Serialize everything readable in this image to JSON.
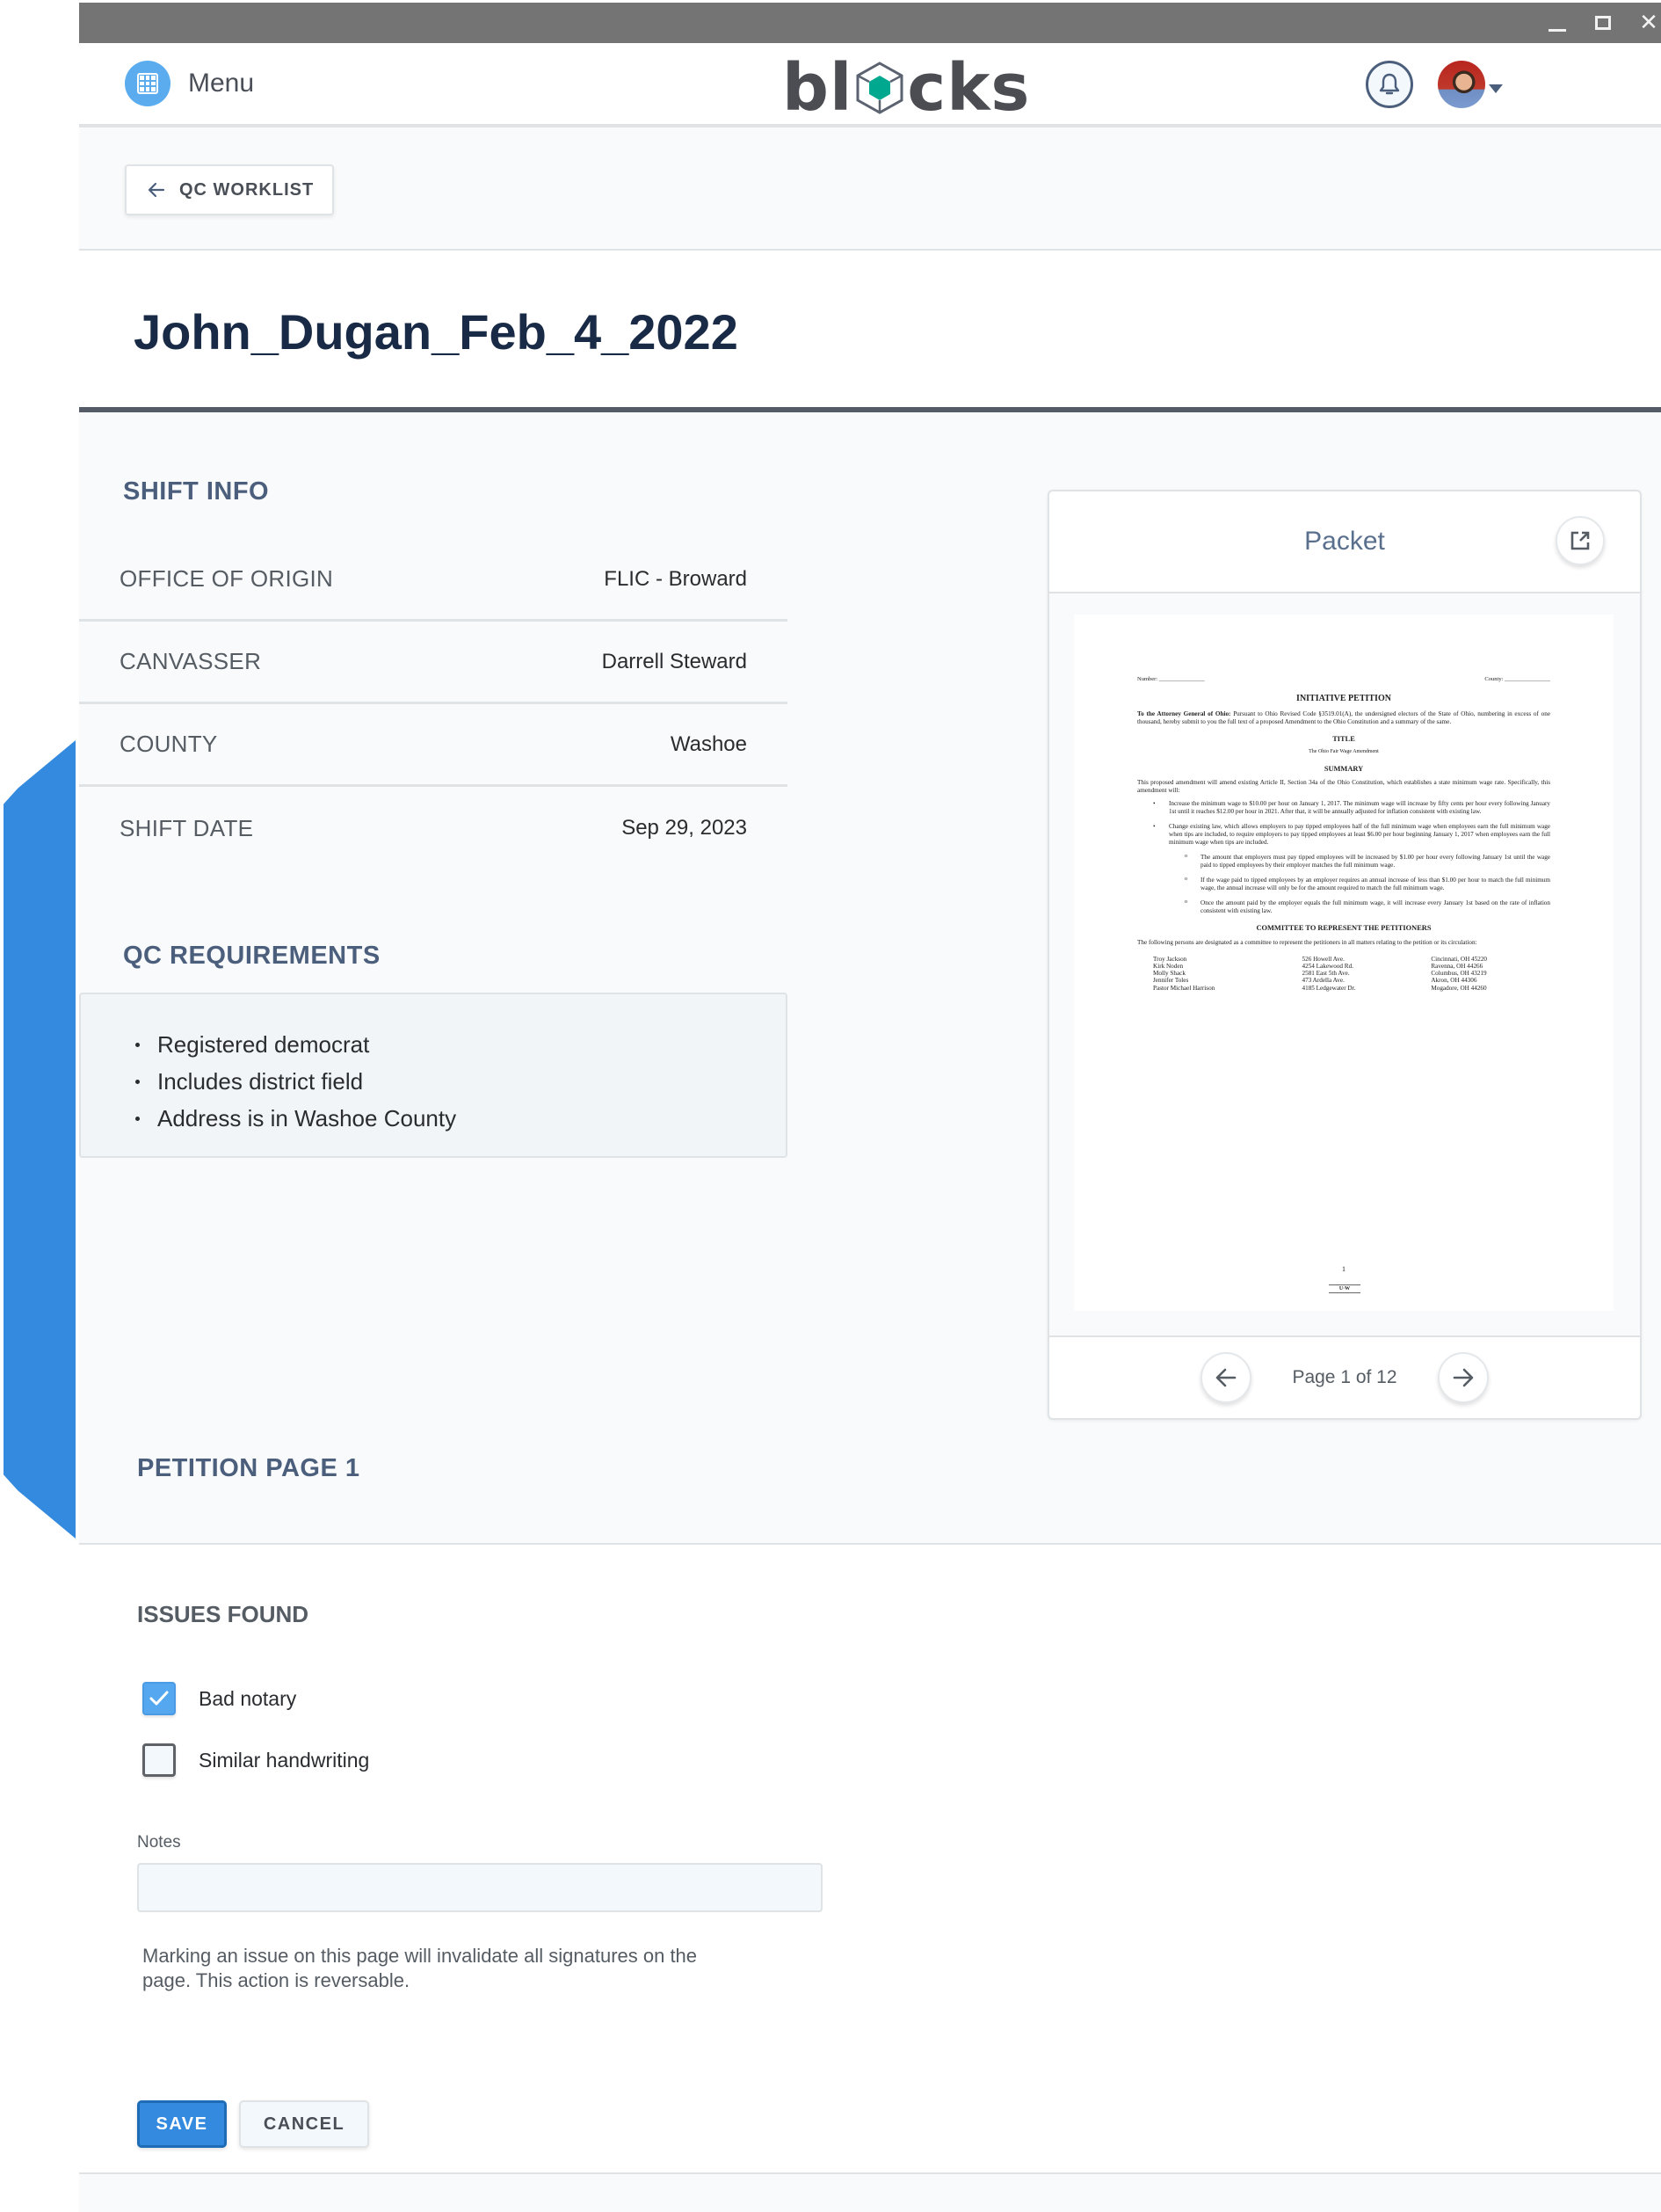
{
  "window": {
    "controls": [
      "minimize",
      "maximize",
      "close"
    ]
  },
  "topnav": {
    "menu_label": "Menu",
    "logo_prefix": "bl",
    "logo_suffix": "cks",
    "brand_color": "#00a88f",
    "bell_icon": "bell-icon",
    "avatar_icon": "user-avatar"
  },
  "breadcrumb": {
    "back_label": "QC WORKLIST",
    "back_icon": "arrow-left-icon"
  },
  "page": {
    "title": "John_Dugan_Feb_4_2022"
  },
  "shift_info": {
    "heading": "SHIFT INFO",
    "rows": [
      {
        "label": "OFFICE OF ORIGIN",
        "value": "FLIC - Broward"
      },
      {
        "label": "CANVASSER",
        "value": "Darrell Steward"
      },
      {
        "label": "COUNTY",
        "value": "Washoe"
      },
      {
        "label": "SHIFT DATE",
        "value": "Sep 29, 2023"
      }
    ]
  },
  "qc_requirements": {
    "heading": "QC REQUIREMENTS",
    "items": [
      "Registered democrat",
      "Includes district field",
      "Address is in Washoe County"
    ]
  },
  "packet": {
    "title": "Packet",
    "open_external_icon": "external-link-icon",
    "page_indicator": "Page 1 of 12",
    "current_page": 1,
    "total_pages": 12,
    "document": {
      "number_label": "Number:",
      "county_label": "County:",
      "heading": "INITIATIVE PETITION",
      "intro_bold": "To the Attorney General of Ohio:",
      "intro": "Pursuant to Ohio Revised Code §3519.01(A), the undersigned electors of the State of Ohio, numbering in excess of one thousand, hereby submit to you the full text of a proposed Amendment to the Ohio Constitution and a summary of the same.",
      "title_heading": "TITLE",
      "title_text": "The Ohio Fair Wage Amendment",
      "summary_heading": "SUMMARY",
      "summary_intro": "This proposed amendment will amend existing Article II, Section 34a of the Ohio Constitution, which establishes a state minimum wage rate. Specifically, this amendment will:",
      "bullets": [
        "Increase the minimum wage to $10.00 per hour on January 1, 2017. The minimum wage will increase by fifty cents per hour every following January 1st until it reaches $12.00 per hour in 2021. After that, it will be annually adjusted for inflation consistent with existing law.",
        "Change existing law, which allows employers to pay tipped employees half of the full minimum wage when employees earn the full minimum wage when tips are included, to require employers to pay tipped employees at least $6.00 per hour beginning January 1, 2017 when employees earn the full minimum wage when tips are included."
      ],
      "sub_bullets": [
        "The amount that employers must pay tipped employees will be increased by $1.00 per hour every following January 1st until the wage paid to tipped employees by their employer matches the full minimum wage.",
        "If the wage paid to tipped employees by an employer requires an annual increase of less than $1.00 per hour to match the full minimum wage, the annual increase will only be for the amount required to match the full minimum wage.",
        "Once the amount paid by the employer equals the full minimum wage, it will increase every January 1st based on the rate of inflation consistent with existing law."
      ],
      "committee_heading": "COMMITTEE TO REPRESENT THE PETITIONERS",
      "committee_intro": "The following persons are designated as a committee to represent the petitioners in all matters relating to the petition or its circulation:",
      "committee": [
        {
          "name": "Troy Jackson",
          "address": "526 Howell Ave.",
          "city": "Cincinnati, OH 45220"
        },
        {
          "name": "Kirk Noden",
          "address": "4254 Lakewood Rd.",
          "city": "Ravenna, OH 44266"
        },
        {
          "name": "Molly Shack",
          "address": "2581 East 5th Ave.",
          "city": "Columbus, OH 43219"
        },
        {
          "name": "Jennifer Toles",
          "address": "473 Ardella Ave.",
          "city": "Akron, OH 44306"
        },
        {
          "name": "Pastor Michael Harrison",
          "address": "4185 Ledgewater Dr.",
          "city": "Mogadore, OH 44260"
        }
      ],
      "page_number": "1",
      "union_bug": "U·W"
    }
  },
  "petition": {
    "heading": "PETITION PAGE 1",
    "issues_heading": "ISSUES FOUND",
    "issues": [
      {
        "label": "Bad notary",
        "checked": true
      },
      {
        "label": "Similar handwriting",
        "checked": false
      }
    ],
    "notes_label": "Notes",
    "notes_value": "",
    "notes_placeholder": "",
    "warning": "Marking an issue on this page will invalidate all signatures on the page. This action is reversable.",
    "save_label": "SAVE",
    "cancel_label": "CANCEL"
  },
  "colors": {
    "accent": "#348ade",
    "heading": "#4b5f7d",
    "title": "#182a45",
    "logo_cube": "#00a88f"
  }
}
